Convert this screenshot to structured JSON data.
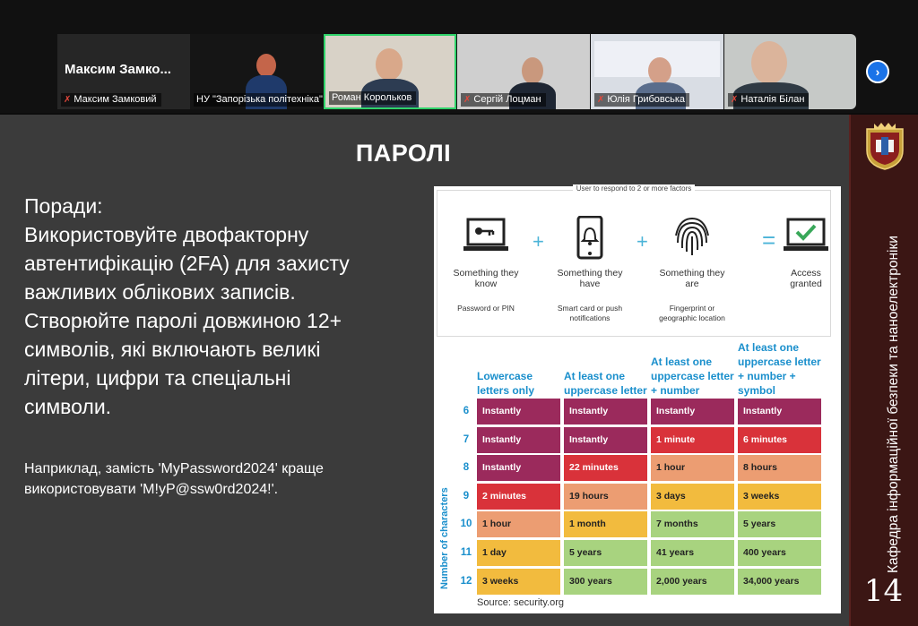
{
  "meeting": {
    "participants": [
      {
        "name": "Максим Замковий",
        "tile_text": "Максим Замко..."
      },
      {
        "name": "НУ \"Запорізька політехніка\""
      },
      {
        "name": "Роман Корольков"
      },
      {
        "name": "Сергій Лоцман"
      },
      {
        "name": "Юлія Грибовська"
      },
      {
        "name": "Наталія Білан"
      }
    ],
    "next_icon": "chevron-right-icon"
  },
  "slide": {
    "title": "ПАРОЛІ",
    "advice_lines": [
      "Поради:",
      "Використовуйте двофакторну",
      "автентифікацію (2FA) для захисту",
      "важливих облікових записів.",
      "Створюйте паролі довжиною 12+",
      "символів, які включають великі",
      "літери, цифри та спеціальні",
      "символи."
    ],
    "example_lines": [
      "Наприклад, замість 'MyPassword2024' краще",
      "використовувати 'M!yP@ssw0rd2024!'."
    ],
    "sidebar_text": "Кафедра інформаційної безпеки та наноелектроніки",
    "crest_text": "НУ З П",
    "page_number": "14"
  },
  "infographic": {
    "caption": "User to respond to 2 or more factors",
    "factors": [
      {
        "label": "Something they know",
        "sub": "Password or PIN",
        "icon": "laptop-key-icon"
      },
      {
        "label": "Something they have",
        "sub": "Smart card or push notifications",
        "icon": "phone-bell-icon"
      },
      {
        "label": "Something they are",
        "sub": "Fingerprint or geographic location",
        "icon": "fingerprint-icon"
      },
      {
        "label": "Access granted",
        "icon": "laptop-check-icon"
      }
    ],
    "colors": {
      "very_fast": "#9b2a5c",
      "fast": "#d9323a",
      "medium": "#ec9d72",
      "slow": "#f2bb3e",
      "safe": "#a8d37f"
    }
  },
  "chart_data": {
    "type": "table",
    "title": "",
    "ylabel": "Number of characters",
    "columns": [
      "Lowercase letters only",
      "At least one uppercase letter",
      "At least one uppercase letter + number",
      "At least one uppercase letter + number + symbol"
    ],
    "rows": [
      6,
      7,
      8,
      9,
      10,
      11,
      12
    ],
    "cells": [
      [
        "Instantly",
        "Instantly",
        "Instantly",
        "Instantly"
      ],
      [
        "Instantly",
        "Instantly",
        "1 minute",
        "6 minutes"
      ],
      [
        "Instantly",
        "22 minutes",
        "1 hour",
        "8 hours"
      ],
      [
        "2 minutes",
        "19 hours",
        "3 days",
        "3 weeks"
      ],
      [
        "1 hour",
        "1 month",
        "7 months",
        "5 years"
      ],
      [
        "1 day",
        "5 years",
        "41 years",
        "400 years"
      ],
      [
        "3 weeks",
        "300 years",
        "2,000 years",
        "34,000 years"
      ]
    ],
    "cell_levels": [
      [
        "very_fast",
        "very_fast",
        "very_fast",
        "very_fast"
      ],
      [
        "very_fast",
        "very_fast",
        "fast",
        "fast"
      ],
      [
        "very_fast",
        "fast",
        "medium",
        "medium"
      ],
      [
        "fast",
        "medium",
        "slow",
        "slow"
      ],
      [
        "medium",
        "slow",
        "safe",
        "safe"
      ],
      [
        "slow",
        "safe",
        "safe",
        "safe"
      ],
      [
        "slow",
        "safe",
        "safe",
        "safe"
      ]
    ],
    "source": "Source: security.org"
  }
}
